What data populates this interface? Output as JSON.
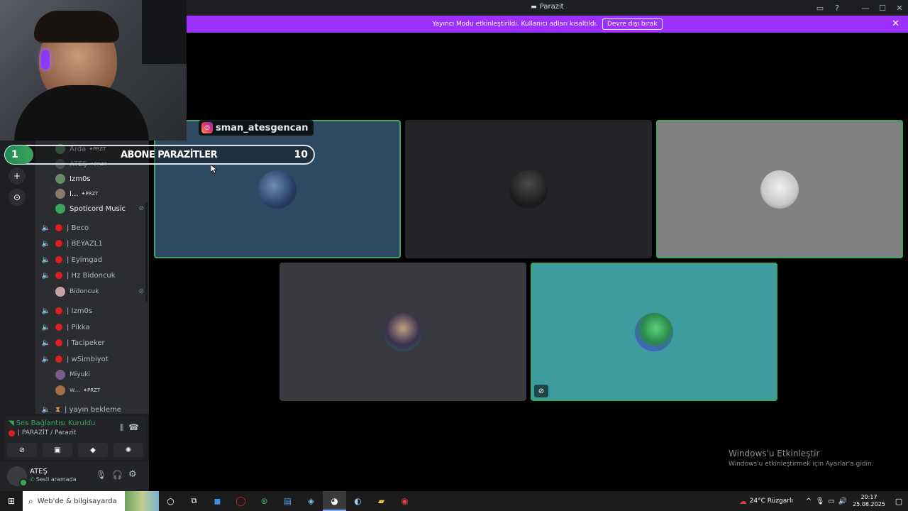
{
  "window": {
    "title": "Parazit"
  },
  "banner": {
    "text": "Yayıncı Modu etkinleştirildi. Kullanıcı adları kısaltıldı.",
    "button_label": "Devre dışı bırak"
  },
  "overlay": {
    "rank": "1",
    "text": "ABONE PARAZİTLER",
    "count": "10",
    "instagram": "sman_atesgencan"
  },
  "channels": {
    "members_top": [
      {
        "name": "Arda",
        "badge": "PRZT"
      },
      {
        "name": "ATEŞ",
        "badge": "PRZT"
      },
      {
        "name": "Izm0s",
        "badge": ""
      },
      {
        "name": "I...",
        "badge": "PRZT"
      },
      {
        "name": "Spoticord Music",
        "badge": ""
      }
    ],
    "voice": [
      {
        "name": "| Beco"
      },
      {
        "name": "| BEYAZL1"
      },
      {
        "name": "| Eyimgad"
      },
      {
        "name": "| Hz Bidoncuk"
      },
      {
        "name": "Bidoncuk",
        "member": true
      },
      {
        "name": "| Izm0s"
      },
      {
        "name": "| Pikka"
      },
      {
        "name": "| Tacipeker"
      },
      {
        "name": "| wSimbiyot"
      },
      {
        "name": "Miyuki",
        "member": true
      },
      {
        "name": "w...",
        "member": true,
        "badge": "PRZT"
      },
      {
        "name": "| yayın bekleme"
      }
    ]
  },
  "voice_panel": {
    "status": "Ses Bağlantısı Kuruldu",
    "channel": "| PARAZİT / Parazit"
  },
  "user": {
    "name": "ATEŞ",
    "status": "Sesli aramada"
  },
  "taskbar": {
    "search_placeholder": "Web'de & bilgisayarda",
    "weather": "24°C  Rüzgarlı",
    "time": "20:17",
    "date": "25.08.2025"
  },
  "watermark": {
    "title": "Windows'u Etkinleştir",
    "subtitle": "Windows'u etkinleştirmek için Ayarlar'a gidin."
  },
  "colors": {
    "accent": "#9b30ff",
    "speaking": "#3ba55d",
    "tile_blue": "#2e4a62",
    "tile_teal": "#3f9c9e"
  }
}
